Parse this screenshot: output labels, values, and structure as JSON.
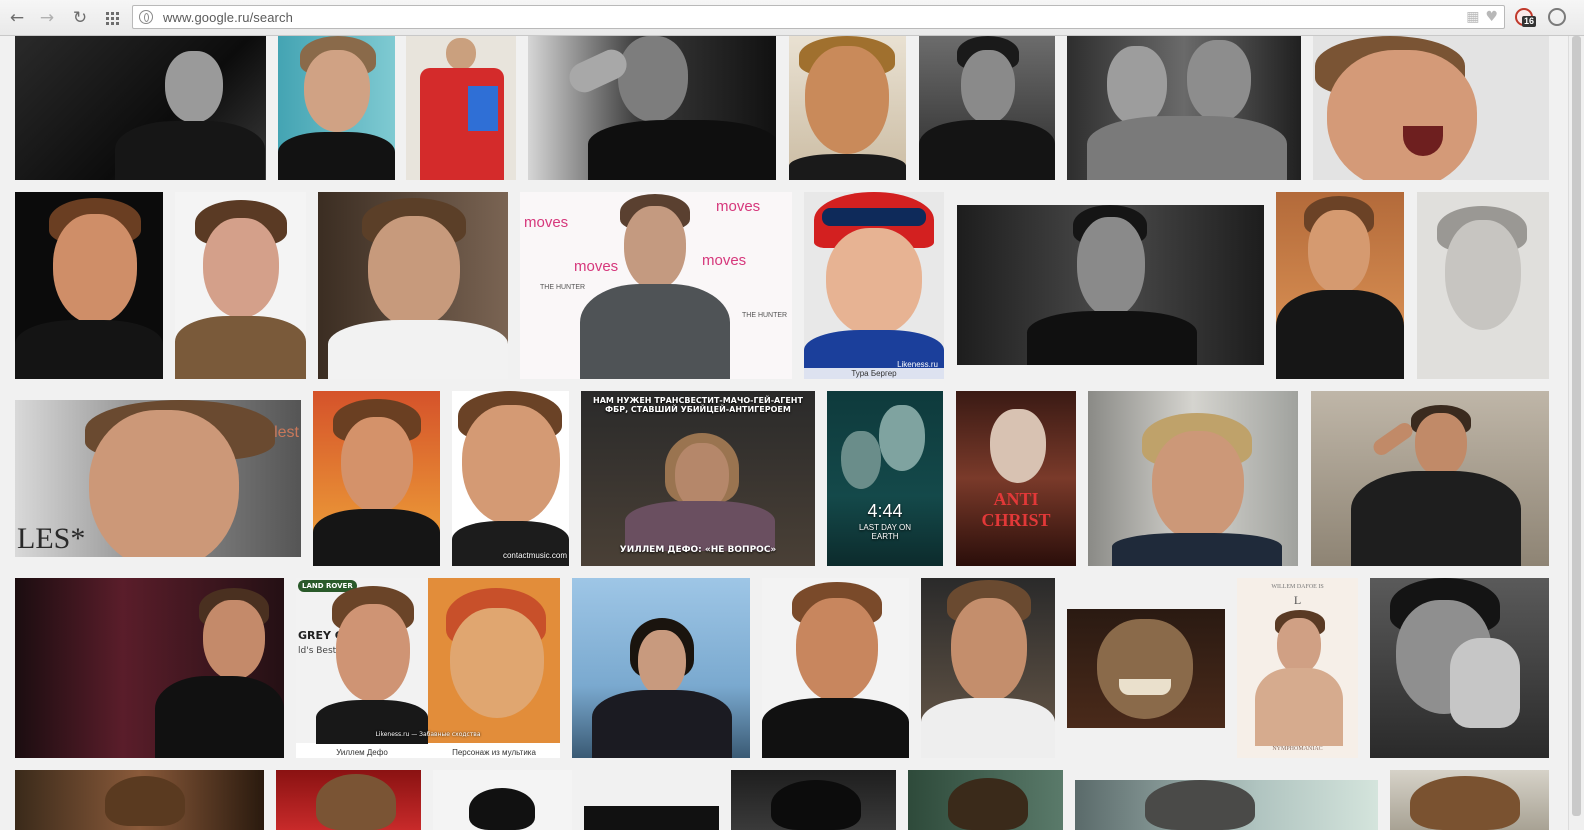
{
  "browser": {
    "url": "www.google.ru/search",
    "extension_badge_count": "16",
    "icons": {
      "back": "back-arrow-icon",
      "forward": "forward-arrow-icon",
      "reload": "reload-icon",
      "apps": "apps-grid-icon",
      "site_info": "globe-icon",
      "bookmark": "heart-icon",
      "menu": "menu-icon"
    }
  },
  "results": {
    "overlay_texts": {
      "meme_top": "НАМ НУЖЕН ТРАНСВЕСТИТ-МАЧО-ГЕЙ-АГЕНТ ФБР, СТАВШИЙ УБИЙЦЕЙ-АНТИГЕРОЕМ",
      "meme_bottom": "УИЛЛЕМ ДЕФО: «НЕ ВОПРОС»",
      "poster_444_title": "4:44",
      "poster_444_sub": "LAST DAY ON EARTH",
      "antichrist_title": "ANTI CHRIST",
      "lookalike_left": "Уиллем Дефо",
      "lookalike_right": "Персонаж из мультика",
      "lookalike_site": "Likeness.ru — Забавные сходства",
      "skier_caption": "Тура Бергер",
      "skier_site": "Likeness.ru",
      "moves_logo": "moves",
      "hunter_text": "THE HUNTER",
      "nymph_title": "NYMPHOMANIAC",
      "nymph_credit": "WILLEM DAFOE IS",
      "nymph_letter": "L",
      "rover_badge": "LAND ROVER",
      "grey_text": "GREY G",
      "best_text": "ld's Best T",
      "les_text": "LES*",
      "lest_text": "lest",
      "contact_site": "contactmusic.com"
    }
  },
  "colors": {
    "page_bg": "#f1f1f1",
    "toolbar_bg": "#eeeeee",
    "skin": "#c99273",
    "hair": "#6b4a32"
  }
}
